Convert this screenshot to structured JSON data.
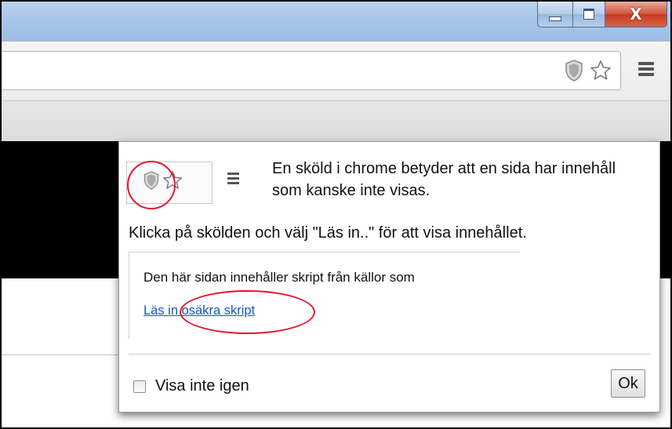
{
  "window": {
    "controls": {
      "minimize_icon": "minimize-icon",
      "maximize_icon": "maximize-icon",
      "close_glyph": "X"
    }
  },
  "toolbar": {
    "omnibox_value": "",
    "icons": [
      "shield-icon",
      "star-icon",
      "chrome-menu-icon"
    ]
  },
  "bubble": {
    "annotation_text": "En sköld i chrome betyder att en sida har innehåll som kanske inte visas.",
    "instruction_text": "Klicka på skölden och välj \"Läs in..\" för att visa innehållet.",
    "message": "Den här sidan innehåller skript från källor som",
    "load_link": "Läs in osäkra skript",
    "checkbox_label": "Visa inte igen",
    "checkbox_checked": false,
    "ok_button": "Ok"
  },
  "colors": {
    "annotation_red": "#e8112d",
    "link_blue": "#1155cc",
    "titlebar_blue": "#a8c6ea",
    "close_red": "#c5391f"
  }
}
